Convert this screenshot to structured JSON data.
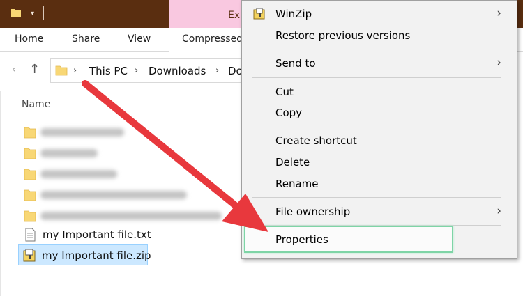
{
  "titlebar": {
    "partial_tab": "Ext"
  },
  "ribbon": {
    "tabs": [
      "Home",
      "Share",
      "View"
    ],
    "compressed_tab": "Compressed"
  },
  "address": {
    "crumbs": [
      "This PC",
      "Downloads",
      "Do"
    ]
  },
  "file_list": {
    "column_name": "Name",
    "files": [
      {
        "name": "my Important file.txt",
        "icon": "text-file-icon"
      },
      {
        "name": "my Important file.zip",
        "icon": "zip-file-icon",
        "selected": true
      }
    ],
    "blurred_folder_count": 5
  },
  "context_menu": {
    "items": [
      {
        "label": "WinZip",
        "submenu": true,
        "icon": "winzip-icon"
      },
      {
        "label": "Restore previous versions"
      },
      {
        "label": "Send to",
        "submenu": true
      },
      {
        "label": "Cut"
      },
      {
        "label": "Copy"
      },
      {
        "label": "Create shortcut"
      },
      {
        "label": "Delete"
      },
      {
        "label": "Rename"
      },
      {
        "label": "File ownership",
        "submenu": true
      },
      {
        "label": "Properties",
        "highlighted": true
      }
    ]
  },
  "colors": {
    "titlebar": "#5a2e10",
    "extract_tab": "#f9c8e0",
    "selection": "#cce8ff",
    "highlight_box": "#7ed4a6",
    "arrow": "#e8383d"
  }
}
